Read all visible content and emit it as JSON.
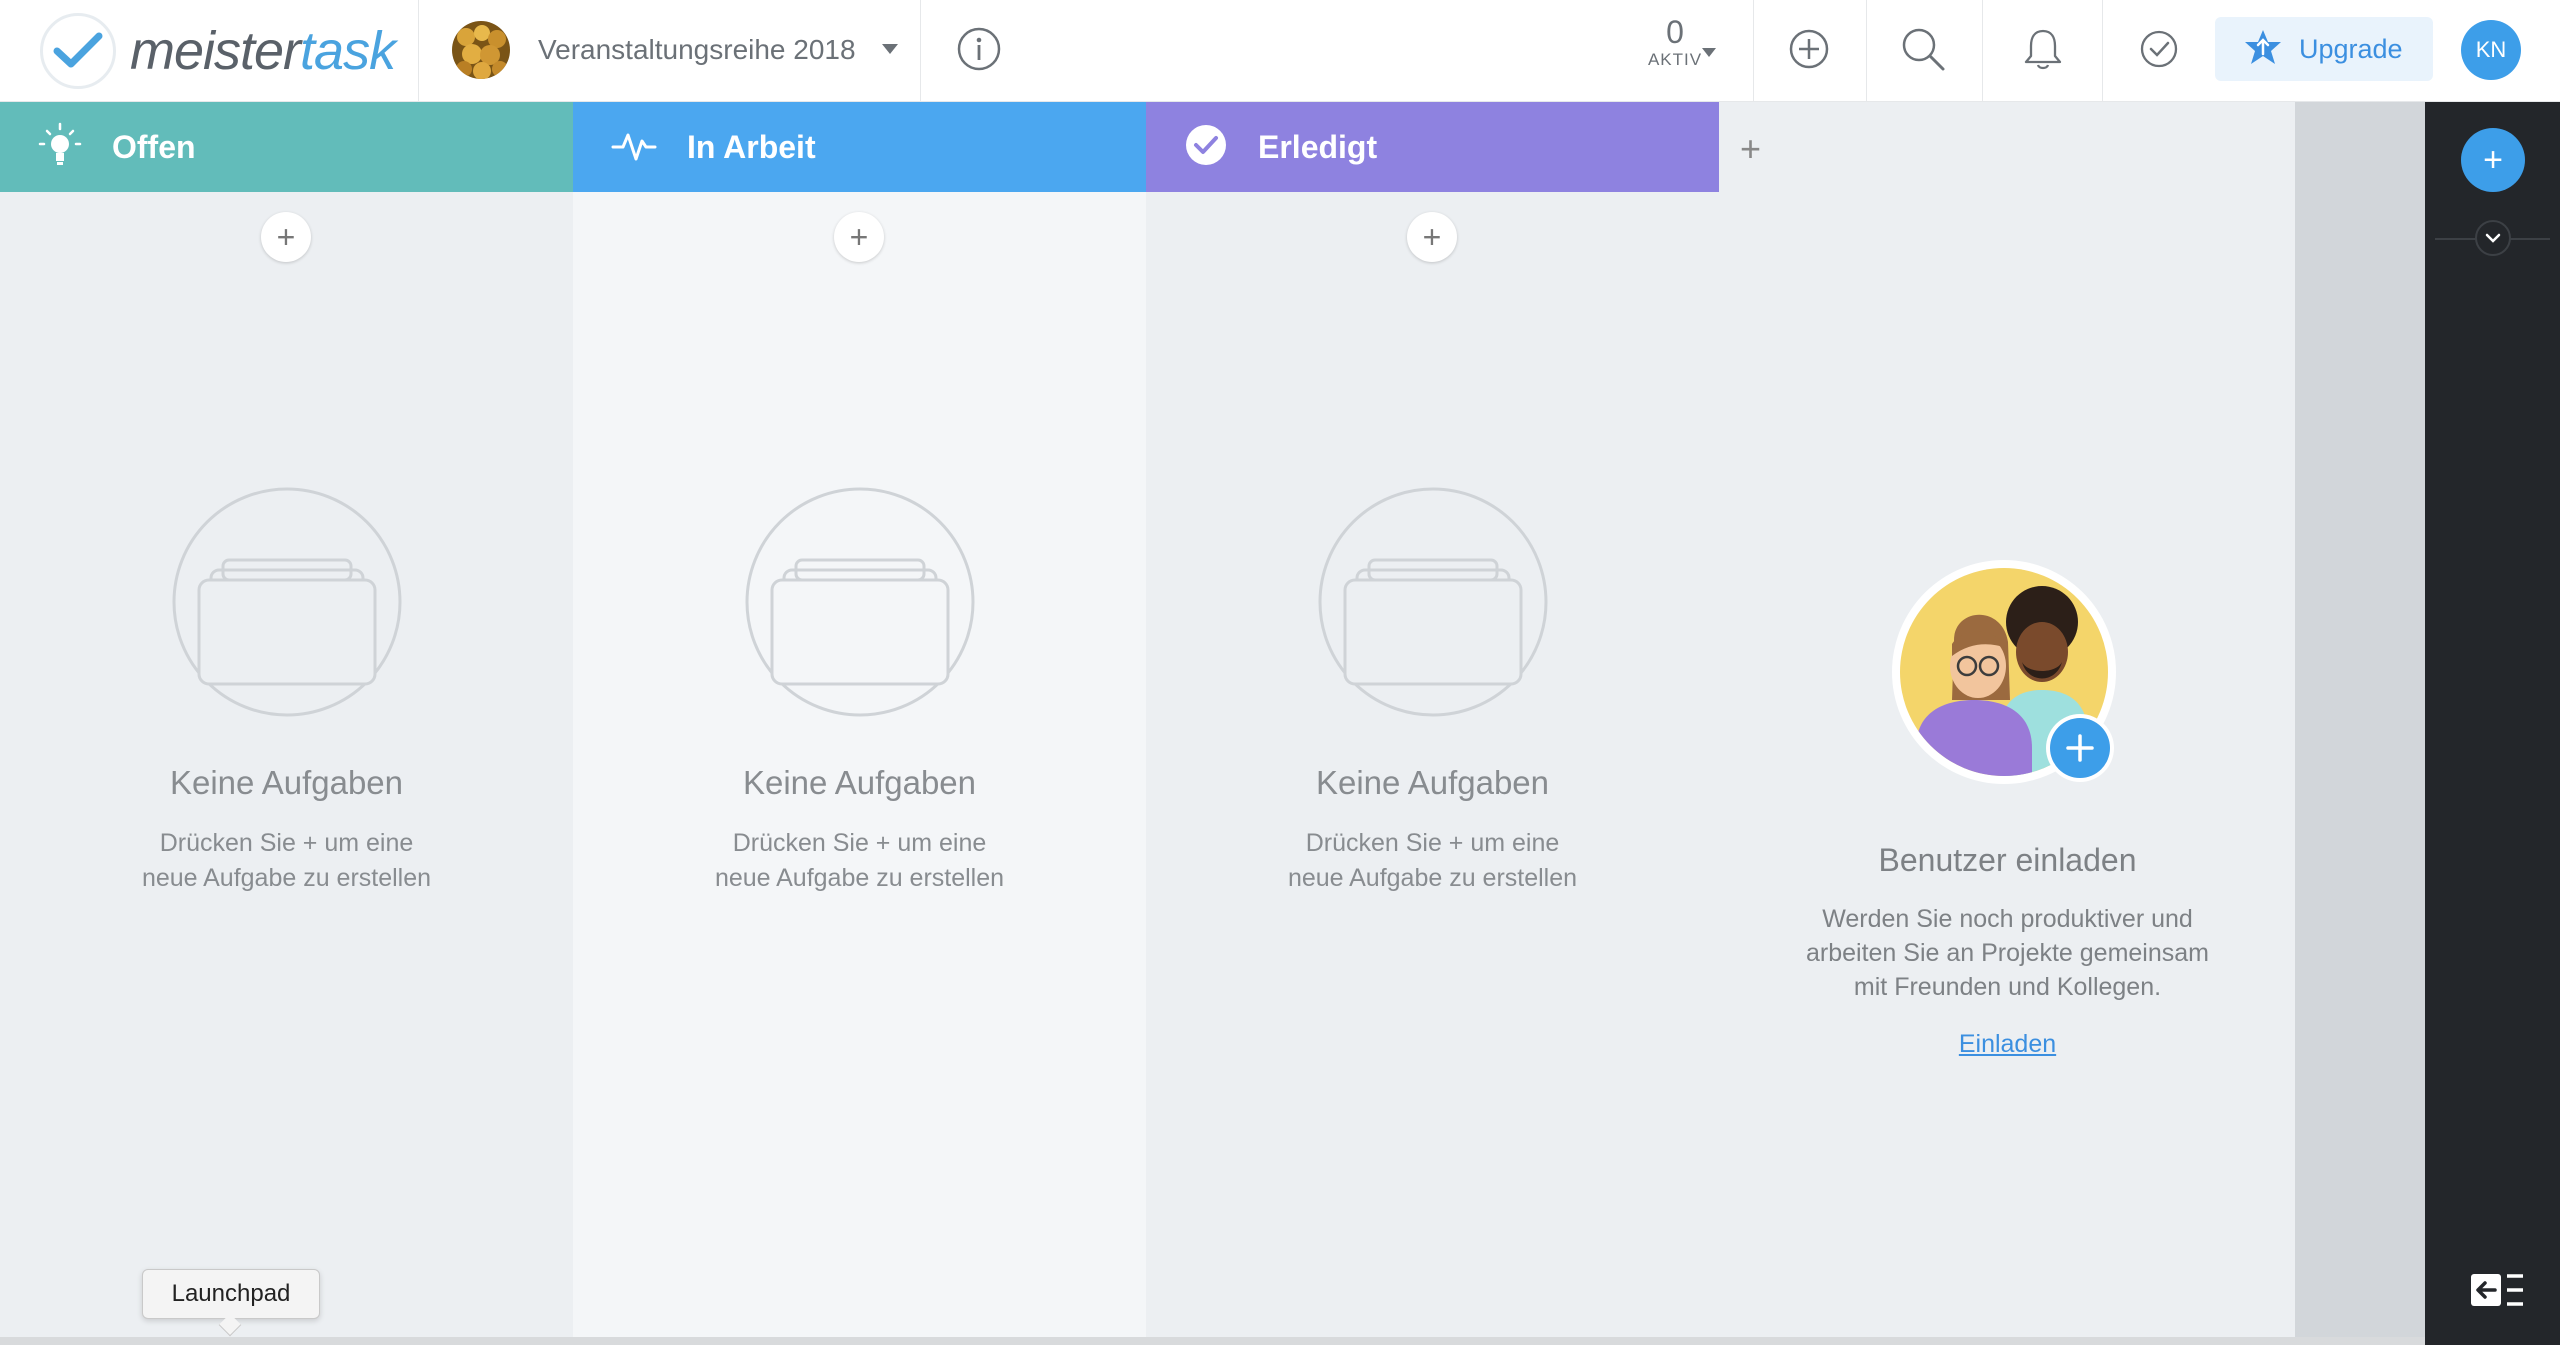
{
  "app": {
    "logo_part1": "meister",
    "logo_part2": "task",
    "brand_color": "#4aa3df"
  },
  "header": {
    "project_name": "Veranstaltungsreihe 2018",
    "active_count": "0",
    "active_label": "AKTIV",
    "upgrade_label": "Upgrade",
    "user_initials": "KN",
    "icons": [
      "info-icon",
      "add-circle-icon",
      "search-icon",
      "bell-icon",
      "check-circle-icon",
      "star-upgrade-icon"
    ]
  },
  "columns": [
    {
      "title": "Offen",
      "color": "#62bcba",
      "body_color": "#eceff2",
      "icon": "lightbulb-icon",
      "empty_title": "Keine Aufgaben",
      "empty_line1": "Drücken Sie + um eine",
      "empty_line2": "neue Aufgabe zu erstellen"
    },
    {
      "title": "In Arbeit",
      "color": "#4ba7f0",
      "body_color": "#f4f6f8",
      "icon": "activity-icon",
      "empty_title": "Keine Aufgaben",
      "empty_line1": "Drücken Sie + um eine",
      "empty_line2": "neue Aufgabe zu erstellen"
    },
    {
      "title": "Erledigt",
      "color": "#8e82e0",
      "body_color": "#eceff2",
      "icon": "check-badge-icon",
      "empty_title": "Keine Aufgaben",
      "empty_line1": "Drücken Sie + um eine",
      "empty_line2": "neue Aufgabe zu erstellen"
    }
  ],
  "add_column_label": "+",
  "invite": {
    "title": "Benutzer einladen",
    "line1": "Werden Sie noch produktiver und",
    "line2": "arbeiten Sie an Projekte gemeinsam",
    "line3": "mit Freunden und Kollegen.",
    "link": "Einladen"
  },
  "tooltip": {
    "text": "Launchpad"
  }
}
